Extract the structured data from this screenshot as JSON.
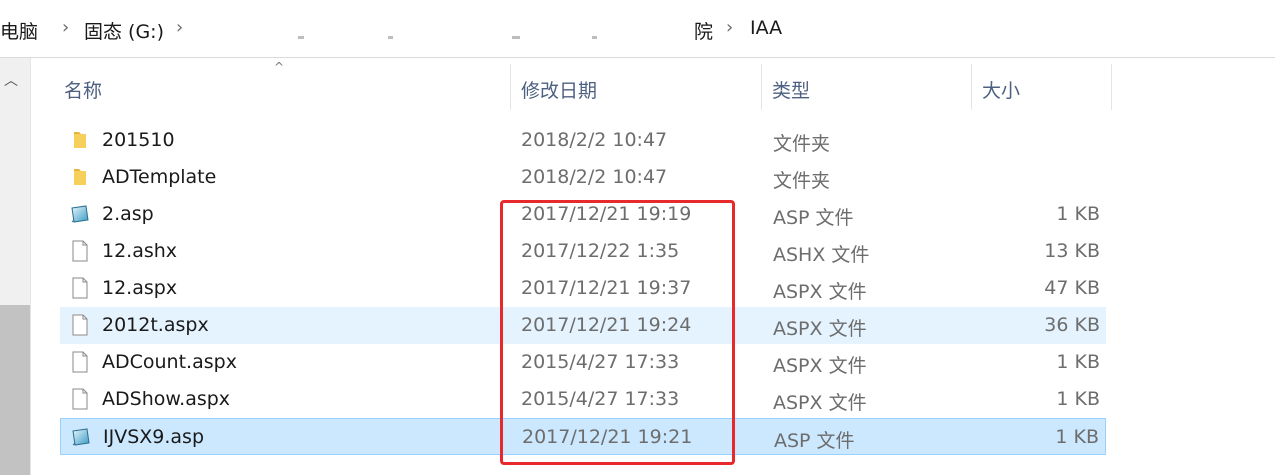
{
  "breadcrumb": {
    "items": [
      "电脑",
      "固态 (G:)",
      "院",
      "IAA"
    ]
  },
  "columns": {
    "name": "名称",
    "modified": "修改日期",
    "type": "类型",
    "size": "大小"
  },
  "files": [
    {
      "name": "201510",
      "modified": "2018/2/2 10:47",
      "type": "文件夹",
      "size": "",
      "icon": "folder-icon"
    },
    {
      "name": "ADTemplate",
      "modified": "2018/2/2 10:47",
      "type": "文件夹",
      "size": "",
      "icon": "folder-icon"
    },
    {
      "name": "2.asp",
      "modified": "2017/12/21 19:19",
      "type": "ASP 文件",
      "size": "1 KB",
      "icon": "asp-file-icon"
    },
    {
      "name": "12.ashx",
      "modified": "2017/12/22 1:35",
      "type": "ASHX 文件",
      "size": "13 KB",
      "icon": "file-icon"
    },
    {
      "name": "12.aspx",
      "modified": "2017/12/21 19:37",
      "type": "ASPX 文件",
      "size": "47 KB",
      "icon": "file-icon"
    },
    {
      "name": "2012t.aspx",
      "modified": "2017/12/21 19:24",
      "type": "ASPX 文件",
      "size": "36 KB",
      "icon": "file-icon"
    },
    {
      "name": "ADCount.aspx",
      "modified": "2015/4/27 17:33",
      "type": "ASPX 文件",
      "size": "1 KB",
      "icon": "file-icon"
    },
    {
      "name": "ADShow.aspx",
      "modified": "2015/4/27 17:33",
      "type": "ASPX 文件",
      "size": "1 KB",
      "icon": "file-icon"
    },
    {
      "name": "IJVSX9.asp",
      "modified": "2017/12/21 19:21",
      "type": "ASP 文件",
      "size": "1 KB",
      "icon": "asp-file-icon"
    }
  ],
  "colors": {
    "highlight_box": "#e8292b",
    "selected_row": "#cce8ff",
    "hover_row": "#e5f3ff",
    "header_text": "#4d6082"
  }
}
